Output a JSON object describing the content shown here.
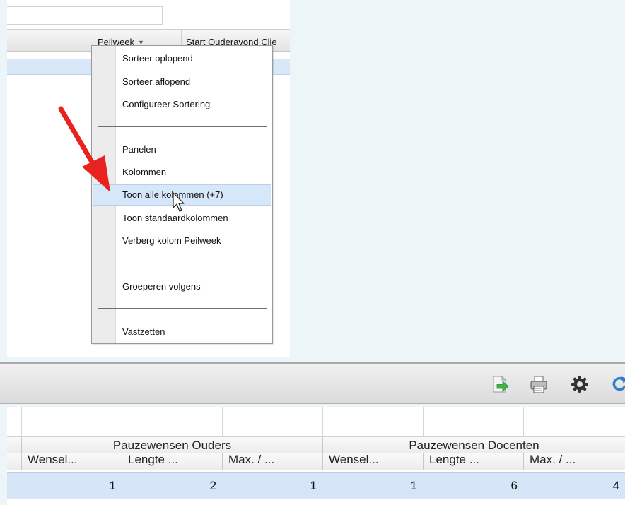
{
  "top_grid": {
    "columns": [
      "Peilweek",
      "Start Ouderavond Clie"
    ],
    "sort_arrow": "▼"
  },
  "context_menu": {
    "items": [
      {
        "label": "Sorteer oplopend"
      },
      {
        "label": "Sorteer aflopend"
      },
      {
        "label": "Configureer Sortering"
      },
      {
        "label": "Panelen"
      },
      {
        "label": "Kolommen"
      },
      {
        "label": "Toon alle kolommen (+7)"
      },
      {
        "label": "Toon standaardkolommen"
      },
      {
        "label": "Verberg kolom Peilweek"
      },
      {
        "label": "Groeperen volgens"
      },
      {
        "label": "Vastzetten"
      }
    ],
    "hovered_index": 5
  },
  "toolbar": {
    "icons": [
      "export-icon",
      "print-icon",
      "settings-gear-icon",
      "refresh-icon"
    ]
  },
  "bottom_grid": {
    "truncated_header": "?",
    "groups": [
      "Pauzewensen Ouders",
      "Pauzewensen Docenten"
    ],
    "sub_columns": [
      "Wensel...",
      "Lengte ...",
      "Max. / ...",
      "Wensel...",
      "Lengte ...",
      "Max. / ..."
    ],
    "row_values": [
      "1",
      "2",
      "1",
      "1",
      "6",
      "4"
    ]
  },
  "colors": {
    "hover": "#d7e7fa",
    "selected_row": "#d6e6f8",
    "arrow": "#e8221f"
  }
}
